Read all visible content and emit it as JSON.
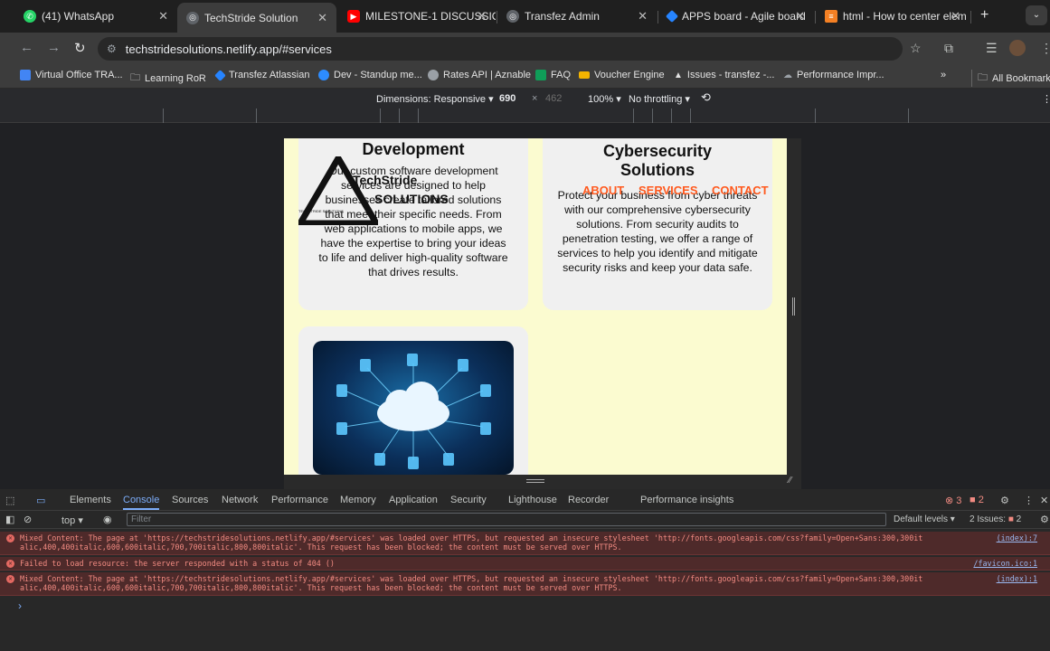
{
  "tabs": [
    {
      "label": "(41) WhatsApp",
      "icon": "whatsapp-icon",
      "color": "#25d366"
    },
    {
      "label": "TechStride Solution",
      "icon": "globe-icon",
      "color": "#5f6368"
    },
    {
      "label": "MILESTONE-1 DISCUSSIO",
      "icon": "youtube-icon",
      "color": "#ff0000"
    },
    {
      "label": "Transfez Admin",
      "icon": "globe-icon",
      "color": "#5f6368"
    },
    {
      "label": "APPS board - Agile board",
      "icon": "jira-icon",
      "color": "#2684ff"
    },
    {
      "label": "html - How to center elem",
      "icon": "stackoverflow-icon",
      "color": "#f48024"
    }
  ],
  "address": {
    "url": "techstridesolutions.netlify.app/#services"
  },
  "bookmarks": [
    {
      "label": "Virtual Office TRA...",
      "color": "#4285f4"
    },
    {
      "label": "Learning RoR",
      "color": "folder"
    },
    {
      "label": "Transfez Atlassian",
      "color": "#2684ff"
    },
    {
      "label": "Dev - Standup me...",
      "color": "#2d8cff"
    },
    {
      "label": "Rates API | Aznable",
      "color": "#9aa0a6"
    },
    {
      "label": "FAQ",
      "color": "#0f9d58"
    },
    {
      "label": "Voucher Engine",
      "color": "#f4b400"
    },
    {
      "label": "Issues - transfez -...",
      "color": "#e3e3e3"
    },
    {
      "label": "Performance Impr...",
      "color": "#9aa0a6"
    }
  ],
  "bookmarks_more": "»",
  "all_bookmarks": "All Bookmarks",
  "device_toolbar": {
    "dimensions": "Dimensions: Responsive ▾",
    "width": "690",
    "times": "×",
    "height": "462",
    "zoom": "100% ▾",
    "throttle": "No throttling ▾"
  },
  "page": {
    "card1": {
      "title": "Development",
      "text": "Our custom software development services are designed to help businesses create tailored solutions that meet their specific needs. From web applications to mobile apps, we have the expertise to bring your ideas to life and deliver high-quality software that drives results."
    },
    "card2": {
      "title": "Cybersecurity Solutions",
      "text": "Protect your business from cyber threats with our comprehensive cybersecurity solutions. From security audits to penetration testing, we offer a range of services to help you identify and mitigate security risks and keep your data safe."
    },
    "logo": {
      "line1": "TechStride",
      "line2": "SOLUTIONS",
      "tiny": "TECHSTRIDE SOLUTIONS"
    },
    "nav": {
      "about": "ABOUT",
      "services": "SERVICES",
      "contact": "CONTACT"
    }
  },
  "devtools": {
    "tabs": [
      "Elements",
      "Console",
      "Sources",
      "Network",
      "Performance",
      "Memory",
      "Application",
      "Security",
      "Lighthouse",
      "Recorder",
      "Performance insights"
    ],
    "active_tab": "Console",
    "errors_count": "3",
    "issues_count": "2",
    "context": "top ▾",
    "filter_placeholder": "Filter",
    "levels": "Default levels ▾",
    "issues_label": "2 Issues:",
    "issues_badge": "2",
    "messages": [
      {
        "text": "Mixed Content: The page at 'https://techstridesolutions.netlify.app/#services' was loaded over HTTPS, but requested an insecure stylesheet 'http://fonts.googleapis.com/css?family=Open+Sans:300,300it alic,400,400italic,600,600italic,700,700italic,800,800italic'. This request has been blocked; the content must be served over HTTPS.",
        "source": "(index):7"
      },
      {
        "text": "Failed to load resource: the server responded with a status of 404 ()",
        "source": "/favicon.ico:1"
      },
      {
        "text": "Mixed Content: The page at 'https://techstridesolutions.netlify.app/#services' was loaded over HTTPS, but requested an insecure stylesheet 'http://fonts.googleapis.com/css?family=Open+Sans:300,300it alic,400,400italic,600,600italic,700,700italic,800,800italic'. This request has been blocked; the content must be served over HTTPS.",
        "source": "(index):1"
      }
    ],
    "prompt": "›"
  },
  "colors": {
    "error_bg": "#4e2a2a",
    "error_text": "#f28b82",
    "page_bg": "#fbfbd0",
    "nav_orange": "#ff5a1f",
    "active_tab": "#7cacf8"
  }
}
